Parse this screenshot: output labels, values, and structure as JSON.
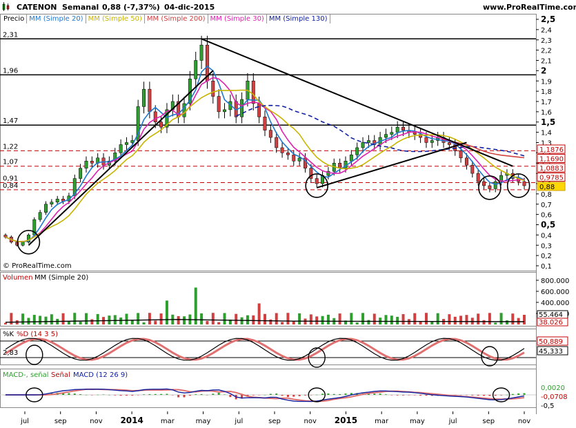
{
  "header": {
    "ticker": "CATENON",
    "period": "Semanal",
    "quote": "0,88 (-7,37%)",
    "date": "04-dic-2015",
    "site": "www.ProRealTime.com",
    "copyright": "© ProRealTime.com"
  },
  "legend_price": [
    {
      "label": "Precio",
      "color": "#000000"
    },
    {
      "label": "MM (Simple 20)",
      "color": "#1e78d0"
    },
    {
      "label": "MM (Simple 50)",
      "color": "#c8b400"
    },
    {
      "label": "MM (Simple 200)",
      "color": "#d04040"
    },
    {
      "label": "MM (Simple 30)",
      "color": "#e020b0"
    },
    {
      "label": "MM (Simple 130)",
      "color": "#1020a0"
    }
  ],
  "legend_volume": [
    "Volumen",
    "MM (Simple 20)"
  ],
  "legend_stoch": [
    "%K",
    "%D (14 3 5)"
  ],
  "legend_macd": [
    "MACD-, señal",
    "Señal",
    "MACD (12 26 9)"
  ],
  "colors": {
    "candle_up": "#2e9e2e",
    "candle_down": "#d04040",
    "sma20": "#1e78d0",
    "sma30": "#e020b0",
    "sma50": "#c8b400",
    "sma200": "#d04040",
    "sma130": "#1020a0",
    "level_red": "#c00000",
    "label_box_red": "#c00000",
    "price_box": "#ffd700"
  },
  "chart_data": [
    {
      "type": "candlestick",
      "title": "CATENON Semanal",
      "ylim": [
        0.1,
        2.5
      ],
      "y_ticks": [
        "2,5",
        "2,4",
        "2,3",
        "2,2",
        "2,1",
        "2",
        "1,9",
        "1,8",
        "1,7",
        "1,6",
        "1,5",
        "1,4",
        "1,3",
        "1,2",
        "1,1",
        "1",
        "0,9",
        "0,8",
        "0,7",
        "0,6",
        "0,5",
        "0,4",
        "0,3",
        "0,2",
        "0,1"
      ],
      "x_tick_labels": [
        "jul",
        "sep",
        "nov",
        "2014",
        "mar",
        "may",
        "jul",
        "sep",
        "nov",
        "2015",
        "mar",
        "may",
        "jul",
        "sep",
        "nov"
      ],
      "horizontal_levels": [
        {
          "value": 2.31,
          "label": "2,31",
          "style": "solid"
        },
        {
          "value": 1.96,
          "label": "1,96",
          "style": "solid"
        },
        {
          "value": 1.47,
          "label": "1,47",
          "style": "solid"
        },
        {
          "value": 1.22,
          "label": "1,22",
          "style": "dashed"
        },
        {
          "value": 1.07,
          "label": "1,07",
          "style": "dashed"
        },
        {
          "value": 0.91,
          "label": "0,91",
          "style": "dashed"
        },
        {
          "value": 0.84,
          "label": "0,84",
          "style": "dashed"
        }
      ],
      "right_labels": [
        {
          "text": "1,1876",
          "series": "sma200"
        },
        {
          "text": "1,1690",
          "series": "sma30"
        },
        {
          "text": "1,0883",
          "series": "sma130"
        },
        {
          "text": "0,9785",
          "series": "sma20"
        },
        {
          "text": "0,88",
          "series": "price"
        }
      ],
      "close_series": [
        0.38,
        0.33,
        0.3,
        0.33,
        0.4,
        0.55,
        0.62,
        0.7,
        0.72,
        0.75,
        0.73,
        0.78,
        0.95,
        1.05,
        1.12,
        1.1,
        1.15,
        1.08,
        1.12,
        1.2,
        1.28,
        1.3,
        1.32,
        1.65,
        1.82,
        1.6,
        1.5,
        1.45,
        1.62,
        1.7,
        1.55,
        1.68,
        1.92,
        2.1,
        2.25,
        1.9,
        1.75,
        1.6,
        1.62,
        1.7,
        1.55,
        1.72,
        1.9,
        1.68,
        1.55,
        1.42,
        1.35,
        1.25,
        1.2,
        1.18,
        1.12,
        1.15,
        1.05,
        0.95,
        0.9,
        0.98,
        1.02,
        1.1,
        1.05,
        1.12,
        1.18,
        1.25,
        1.3,
        1.32,
        1.28,
        1.35,
        1.38,
        1.4,
        1.45,
        1.42,
        1.4,
        1.38,
        1.35,
        1.3,
        1.32,
        1.35,
        1.3,
        1.28,
        1.22,
        1.15,
        1.08,
        1.0,
        0.92,
        0.88,
        0.85,
        0.92,
        0.98,
        1.0,
        0.95,
        0.92,
        0.88
      ]
    },
    {
      "type": "bar",
      "title": "Volumen",
      "ylim": [
        0,
        900000
      ],
      "y_ticks": [
        "800.000",
        "600.000",
        "400.000",
        "200.000"
      ],
      "right_labels": [
        "55.464",
        "38.026"
      ]
    },
    {
      "type": "line",
      "title": "%K %D (14 3 5)",
      "ylim": [
        0,
        100
      ],
      "levels": [
        {
          "label": "50,889"
        },
        {
          "label": "45,333"
        }
      ],
      "left_label": "2,83"
    },
    {
      "type": "line",
      "title": "MACD (12 26 9)",
      "right_labels": [
        "0,0020",
        "-0,0708",
        "-0,5"
      ]
    }
  ]
}
